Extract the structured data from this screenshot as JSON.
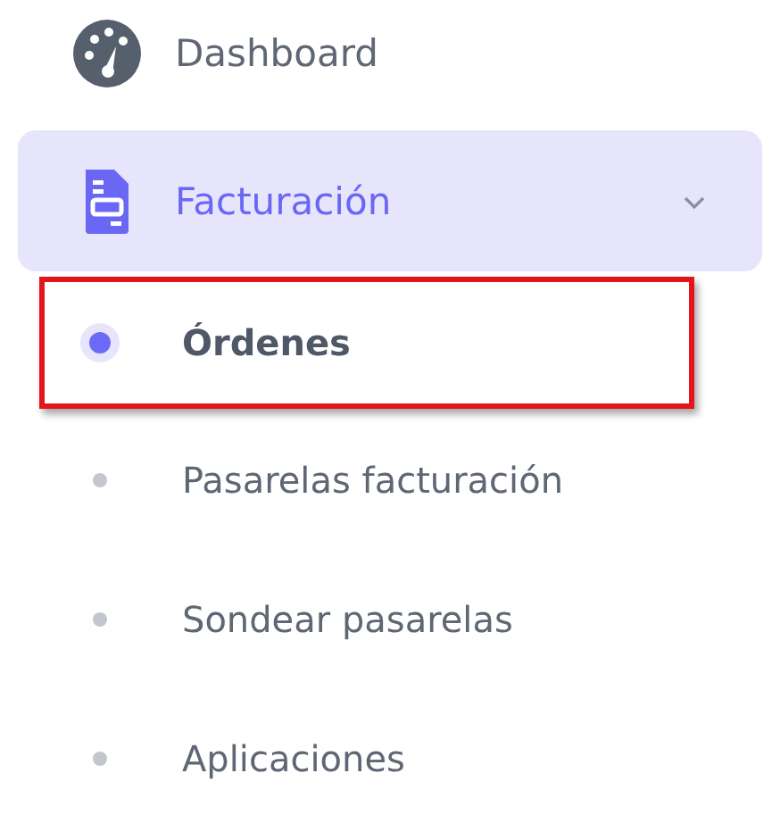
{
  "sidebar": {
    "items": [
      {
        "kind": "link",
        "label": "Dashboard",
        "selected": false
      },
      {
        "kind": "group",
        "label": "Facturación",
        "selected": true,
        "expanded": true,
        "children": [
          {
            "label": "Órdenes",
            "selected": true,
            "highlighted": true
          },
          {
            "label": "Pasarelas facturación",
            "selected": false,
            "highlighted": false
          },
          {
            "label": "Sondear pasarelas",
            "selected": false,
            "highlighted": false
          },
          {
            "label": "Aplicaciones",
            "selected": false,
            "highlighted": false
          }
        ]
      }
    ]
  }
}
